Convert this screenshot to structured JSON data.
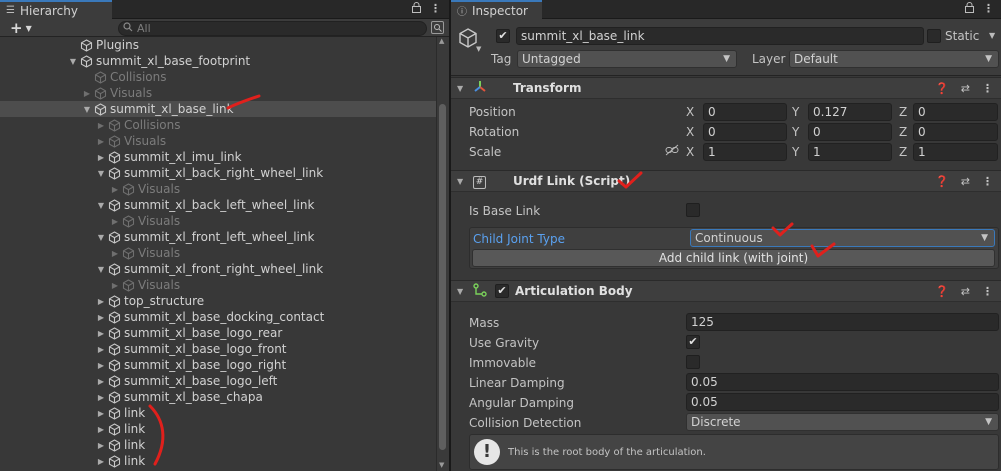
{
  "hierarchy": {
    "tab_label": "Hierarchy",
    "add_label": "+",
    "search_placeholder": "All",
    "items": [
      {
        "label": "Plugins",
        "arrow": "",
        "dim": false,
        "indent": 0
      },
      {
        "label": "summit_xl_base_footprint",
        "arrow": "▼",
        "dim": false,
        "indent": 0
      },
      {
        "label": "Collisions",
        "arrow": "",
        "dim": true,
        "indent": 1
      },
      {
        "label": "Visuals",
        "arrow": "▶",
        "dim": true,
        "indent": 1
      },
      {
        "label": "summit_xl_base_link",
        "arrow": "▼",
        "dim": false,
        "indent": 1,
        "selected": true
      },
      {
        "label": "Collisions",
        "arrow": "▶",
        "dim": true,
        "indent": 2
      },
      {
        "label": "Visuals",
        "arrow": "▶",
        "dim": true,
        "indent": 2
      },
      {
        "label": "summit_xl_imu_link",
        "arrow": "▶",
        "dim": false,
        "indent": 2
      },
      {
        "label": "summit_xl_back_right_wheel_link",
        "arrow": "▼",
        "dim": false,
        "indent": 2
      },
      {
        "label": "Visuals",
        "arrow": "▶",
        "dim": true,
        "indent": 3
      },
      {
        "label": "summit_xl_back_left_wheel_link",
        "arrow": "▼",
        "dim": false,
        "indent": 2
      },
      {
        "label": "Visuals",
        "arrow": "▶",
        "dim": true,
        "indent": 3
      },
      {
        "label": "summit_xl_front_left_wheel_link",
        "arrow": "▼",
        "dim": false,
        "indent": 2
      },
      {
        "label": "Visuals",
        "arrow": "▶",
        "dim": true,
        "indent": 3
      },
      {
        "label": "summit_xl_front_right_wheel_link",
        "arrow": "▼",
        "dim": false,
        "indent": 2
      },
      {
        "label": "Visuals",
        "arrow": "▶",
        "dim": true,
        "indent": 3
      },
      {
        "label": "top_structure",
        "arrow": "▶",
        "dim": false,
        "indent": 2
      },
      {
        "label": "summit_xl_base_docking_contact",
        "arrow": "▶",
        "dim": false,
        "indent": 2
      },
      {
        "label": "summit_xl_base_logo_rear",
        "arrow": "▶",
        "dim": false,
        "indent": 2
      },
      {
        "label": "summit_xl_base_logo_front",
        "arrow": "▶",
        "dim": false,
        "indent": 2
      },
      {
        "label": "summit_xl_base_logo_right",
        "arrow": "▶",
        "dim": false,
        "indent": 2
      },
      {
        "label": "summit_xl_base_logo_left",
        "arrow": "▶",
        "dim": false,
        "indent": 2
      },
      {
        "label": "summit_xl_base_chapa",
        "arrow": "▶",
        "dim": false,
        "indent": 2
      },
      {
        "label": "link",
        "arrow": "▶",
        "dim": false,
        "indent": 2
      },
      {
        "label": "link",
        "arrow": "▶",
        "dim": false,
        "indent": 2
      },
      {
        "label": "link",
        "arrow": "▶",
        "dim": false,
        "indent": 2
      },
      {
        "label": "link",
        "arrow": "▶",
        "dim": false,
        "indent": 2
      }
    ]
  },
  "inspector": {
    "tab_label": "Inspector",
    "object_name": "summit_xl_base_link",
    "active": true,
    "static_label": "Static",
    "tag_label": "Tag",
    "tag_value": "Untagged",
    "layer_label": "Layer",
    "layer_value": "Default",
    "transform": {
      "title": "Transform",
      "position_label": "Position",
      "rotation_label": "Rotation",
      "scale_label": "Scale",
      "axis_x": "X",
      "axis_y": "Y",
      "axis_z": "Z",
      "position": {
        "x": "0",
        "y": "0.127",
        "z": "0"
      },
      "rotation": {
        "x": "0",
        "y": "0",
        "z": "0"
      },
      "scale": {
        "x": "1",
        "y": "1",
        "z": "1"
      }
    },
    "urdf": {
      "title": "Urdf Link (Script)",
      "is_base_link_label": "Is Base Link",
      "is_base_link": false,
      "child_joint_type_label": "Child Joint Type",
      "child_joint_type_value": "Continuous",
      "add_child_button": "Add child link (with joint)"
    },
    "articulation": {
      "title": "Articulation Body",
      "enabled": true,
      "mass_label": "Mass",
      "mass_value": "125",
      "use_gravity_label": "Use Gravity",
      "use_gravity": true,
      "immovable_label": "Immovable",
      "immovable": false,
      "linear_damping_label": "Linear Damping",
      "linear_damping_value": "0.05",
      "angular_damping_label": "Angular Damping",
      "angular_damping_value": "0.05",
      "collision_detection_label": "Collision Detection",
      "collision_detection_value": "Discrete",
      "info_text": "This is the root body of the articulation."
    }
  },
  "colors": {
    "accent": "#3a79bb",
    "annotation": "#e0201c",
    "link_label": "#5aa1f0"
  }
}
